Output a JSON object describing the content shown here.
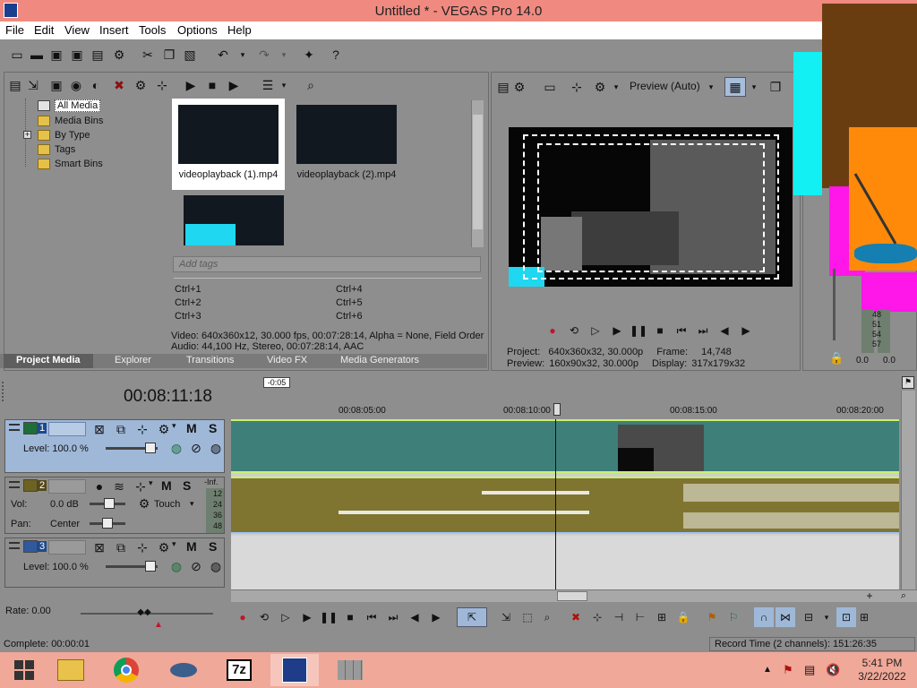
{
  "window": {
    "title": "Untitled * - VEGAS Pro 14.0"
  },
  "menu": [
    "File",
    "Edit",
    "View",
    "Insert",
    "Tools",
    "Options",
    "Help"
  ],
  "project_media": {
    "tree": [
      "All Media",
      "Media Bins",
      "By Type",
      "Tags",
      "Smart Bins"
    ],
    "expand_glyph": "+",
    "thumbs": [
      "videoplayback (1).mp4",
      "videoplayback (2).mp4"
    ],
    "tags_placeholder": "Add tags",
    "shortcuts_left": [
      "Ctrl+1",
      "Ctrl+2",
      "Ctrl+3"
    ],
    "shortcuts_right": [
      "Ctrl+4",
      "Ctrl+5",
      "Ctrl+6"
    ],
    "props_video": "Video: 640x360x12, 30.000 fps, 00:07:28:14, Alpha = None, Field Order",
    "props_audio": "Audio: 44,100 Hz, Stereo, 00:07:28:14, AAC",
    "tabs": [
      "Project Media",
      "Explorer",
      "Transitions",
      "Video FX",
      "Media Generators"
    ]
  },
  "preview": {
    "quality": "Preview (Auto)",
    "project_label": "Project:",
    "project_value": "640x360x32, 30.000p",
    "preview_label": "Preview:",
    "preview_value": "160x90x32, 30.000p",
    "frame_label": "Frame:",
    "frame_value": "14,748",
    "display_label": "Display:",
    "display_value": "317x179x32"
  },
  "meter": {
    "ticks": [
      "48",
      "51",
      "54",
      "57"
    ],
    "values": [
      "0.0",
      "0.0"
    ]
  },
  "timeline": {
    "timecode": "00:08:11:18",
    "offset_badge": "-0:05",
    "ruler": [
      "00:08:05:00",
      "00:08:10:00",
      "00:08:15:00",
      "00:08:20:00"
    ],
    "tracks": [
      {
        "num": "1",
        "type": "video",
        "level_label": "Level: 100.0 %"
      },
      {
        "num": "2",
        "type": "audio",
        "vol_label": "Vol:",
        "vol_value": "0.0 dB",
        "pan_label": "Pan:",
        "pan_value": "Center",
        "mode": "Touch",
        "inf": "-Inf.",
        "db_ticks": [
          "12",
          "24",
          "36",
          "48"
        ]
      },
      {
        "num": "3",
        "type": "video",
        "level_label": "Level: 100.0 %"
      }
    ],
    "mute_label": "M",
    "solo_label": "S"
  },
  "rate": "Rate: 0.00",
  "status": {
    "complete": "Complete: 00:00:01",
    "record_time": "Record Time (2 channels): 151:26:35"
  },
  "taskbar": {
    "time": "5:41 PM",
    "date": "3/22/2022",
    "apps": [
      "windows-logo",
      "file-explorer",
      "chrome",
      "vegas-helper",
      "7zip",
      "vegas-pro",
      "brick-app"
    ],
    "zip_label": "7z"
  },
  "colors": {
    "title_bar": "#f08a80",
    "taskbar": "#f0a898",
    "video_track": "#3e7f7a",
    "audio_track": "#7f7530",
    "selection": "#9fb8d8"
  }
}
